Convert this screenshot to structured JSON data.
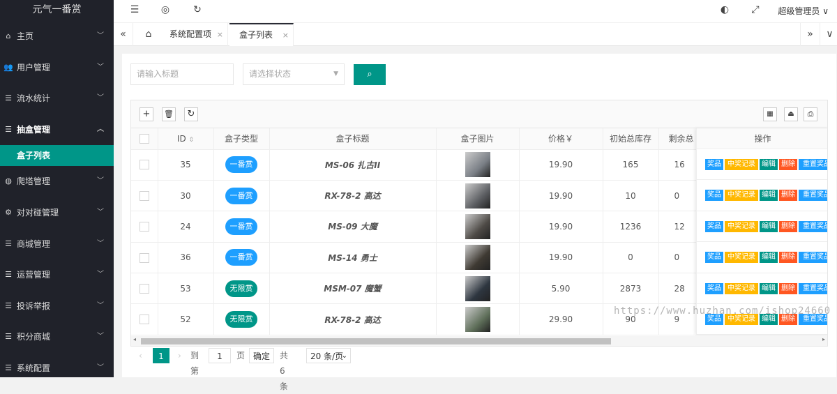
{
  "app": {
    "logo": "元气一番赏"
  },
  "sidebar": {
    "items": [
      {
        "label": "主页",
        "icon": "⌂"
      },
      {
        "label": "用户管理",
        "icon": "👥"
      },
      {
        "label": "流水统计",
        "icon": "☰"
      },
      {
        "label": "抽盒管理",
        "icon": "☰"
      },
      {
        "label": "爬塔管理",
        "icon": "◍"
      },
      {
        "label": "对对碰管理",
        "icon": "⚙"
      },
      {
        "label": "商城管理",
        "icon": "☰"
      },
      {
        "label": "运营管理",
        "icon": "☰"
      },
      {
        "label": "投诉举报",
        "icon": "☰"
      },
      {
        "label": "积分商城",
        "icon": "☰"
      },
      {
        "label": "系统配置",
        "icon": "☰"
      }
    ],
    "sub_item": "盒子列表"
  },
  "topbar": {
    "user": "超级管理员"
  },
  "tabs": {
    "items": [
      {
        "label": "系统配置项"
      },
      {
        "label": "盒子列表"
      }
    ]
  },
  "search": {
    "title_placeholder": "请输入标题",
    "status_placeholder": "请选择状态"
  },
  "table": {
    "headers": {
      "id": "ID",
      "type": "盒子类型",
      "title": "盒子标题",
      "image": "盒子图片",
      "price": "价格￥",
      "init_stock": "初始总库存",
      "remain": "剩余总",
      "ops": "操作"
    },
    "rows": [
      {
        "id": "35",
        "type": "一番赏",
        "type_color": "#1e9fff",
        "title": "MS-06 扎古II",
        "price": "19.90",
        "init": "165",
        "remain": "16"
      },
      {
        "id": "30",
        "type": "一番赏",
        "type_color": "#1e9fff",
        "title": "RX-78-2 高达",
        "price": "19.90",
        "init": "10",
        "remain": "0"
      },
      {
        "id": "24",
        "type": "一番赏",
        "type_color": "#1e9fff",
        "title": "MS-09 大魔",
        "price": "19.90",
        "init": "1236",
        "remain": "12"
      },
      {
        "id": "36",
        "type": "一番赏",
        "type_color": "#1e9fff",
        "title": "MS-14 勇士",
        "price": "19.90",
        "init": "0",
        "remain": "0"
      },
      {
        "id": "53",
        "type": "无限赏",
        "type_color": "#009688",
        "title": "MSM-07 魔蟹",
        "price": "5.90",
        "init": "2873",
        "remain": "28"
      },
      {
        "id": "52",
        "type": "无限赏",
        "type_color": "#009688",
        "title": "RX-78-2 高达",
        "price": "29.90",
        "init": "90",
        "remain": "9"
      }
    ],
    "ops": [
      {
        "label": "奖品",
        "color": "#1e9fff"
      },
      {
        "label": "中奖记录",
        "color": "#ffb800"
      },
      {
        "label": "编辑",
        "color": "#009688"
      },
      {
        "label": "删除",
        "color": "#ff5722"
      },
      {
        "label": "重置奖品池",
        "color": "#1e9fff"
      }
    ]
  },
  "pager": {
    "current": "1",
    "goto_label": "到第",
    "goto_value": "1",
    "page_label": "页",
    "confirm": "确定",
    "total": "共 6 条",
    "per_page": "20 条/页"
  },
  "watermark": "https://www.huzhan.com/ishop24660"
}
